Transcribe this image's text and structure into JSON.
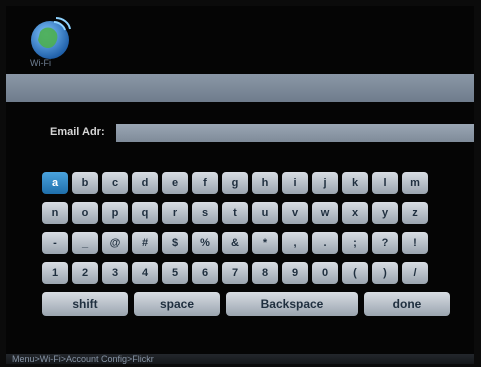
{
  "app": {
    "logo_label": "Wi-Fi"
  },
  "form": {
    "email_label": "Email Adr:",
    "email_value": ""
  },
  "keyboard": {
    "rows": [
      [
        "a",
        "b",
        "c",
        "d",
        "e",
        "f",
        "g",
        "h",
        "i",
        "j",
        "k",
        "l",
        "m"
      ],
      [
        "n",
        "o",
        "p",
        "q",
        "r",
        "s",
        "t",
        "u",
        "v",
        "w",
        "x",
        "y",
        "z"
      ],
      [
        "-",
        "_",
        "@",
        "#",
        "$",
        "%",
        "&",
        "*",
        ",",
        ".",
        ";",
        "?",
        "!"
      ],
      [
        "1",
        "2",
        "3",
        "4",
        "5",
        "6",
        "7",
        "8",
        "9",
        "0",
        "(",
        ")",
        "/"
      ]
    ],
    "active_key": "a",
    "controls": [
      "shift",
      "space",
      "Backspace",
      "done"
    ]
  },
  "footer": {
    "breadcrumb": "Menu>Wi-Fi>Account Config>Flickr"
  },
  "colors": {
    "accent": "#2f86c7",
    "key": "#c7ced6",
    "background": "#050505"
  }
}
